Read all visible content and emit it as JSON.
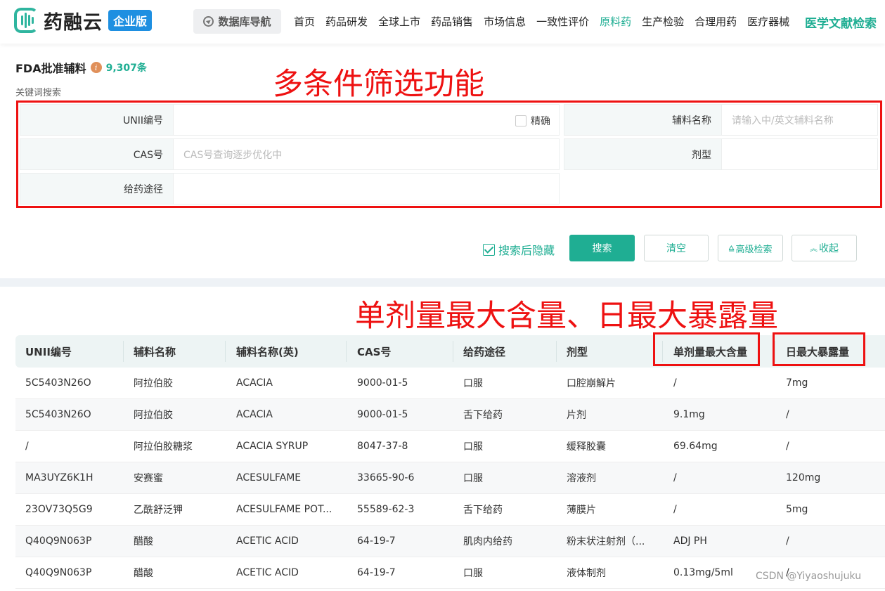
{
  "brand": {
    "name": "药融云",
    "edition": "企业版",
    "color": "#2fb59f"
  },
  "db_nav_label": "数据库导航",
  "nav": [
    {
      "label": "首页",
      "active": false
    },
    {
      "label": "药品研发",
      "active": false
    },
    {
      "label": "全球上市",
      "active": false
    },
    {
      "label": "药品销售",
      "active": false
    },
    {
      "label": "市场信息",
      "active": false
    },
    {
      "label": "一致性评价",
      "active": false
    },
    {
      "label": "原料药",
      "active": true
    },
    {
      "label": "生产检验",
      "active": false
    },
    {
      "label": "合理用药",
      "active": false
    },
    {
      "label": "医疗器械",
      "active": false
    }
  ],
  "literature_link": "医学文献检索",
  "accent_color": "#1fae93",
  "page": {
    "title": "FDA批准辅料",
    "count": "9,307条",
    "keyword_label": "关键词搜索"
  },
  "annotations": {
    "filter": "多条件筛选功能",
    "columns": "单剂量最大含量、日最大暴露量"
  },
  "filters": {
    "unii": {
      "label": "UNII编号",
      "value": "",
      "exact_label": "精确"
    },
    "excipient_name": {
      "label": "辅料名称",
      "placeholder": "请输入中/英文辅料名称"
    },
    "cas": {
      "label": "CAS号",
      "placeholder": "CAS号查询逐步优化中"
    },
    "dosage_form": {
      "label": "剂型",
      "value": ""
    },
    "route": {
      "label": "给药途径",
      "value": ""
    }
  },
  "actions": {
    "hide_after_search": "搜索后隐藏",
    "search": "搜索",
    "clear": "清空",
    "advanced": "高级检索",
    "collapse": "收起"
  },
  "table": {
    "columns": [
      "UNII编号",
      "辅料名称",
      "辅料名称(英)",
      "CAS号",
      "给药途径",
      "剂型",
      "单剂量最大含量",
      "日最大暴露量"
    ],
    "rows": [
      [
        "5C5403N26O",
        "阿拉伯胶",
        "ACACIA",
        "9000-01-5",
        "口服",
        "口腔崩解片",
        "/",
        "7mg"
      ],
      [
        "5C5403N26O",
        "阿拉伯胶",
        "ACACIA",
        "9000-01-5",
        "舌下给药",
        "片剂",
        "9.1mg",
        "/"
      ],
      [
        "/",
        "阿拉伯胶糖浆",
        "ACACIA SYRUP",
        "8047-37-8",
        "口服",
        "缓释胶囊",
        "69.64mg",
        "/"
      ],
      [
        "MA3UYZ6K1H",
        "安赛蜜",
        "ACESULFAME",
        "33665-90-6",
        "口服",
        "溶液剂",
        "/",
        "120mg"
      ],
      [
        "23OV73Q5G9",
        "乙酰舒泛钾",
        "ACESULFAME POT...",
        "55589-62-3",
        "舌下给药",
        "薄膜片",
        "/",
        "5mg"
      ],
      [
        "Q40Q9N063P",
        "醋酸",
        "ACETIC ACID",
        "64-19-7",
        "肌肉内给药",
        "粉末状注射剂（...",
        "ADJ PH",
        "/"
      ],
      [
        "Q40Q9N063P",
        "醋酸",
        "ACETIC ACID",
        "64-19-7",
        "口服",
        "液体制剂",
        "0.13mg/5ml",
        "/"
      ]
    ]
  },
  "watermark": "CSDN @Yiyaoshujuku"
}
